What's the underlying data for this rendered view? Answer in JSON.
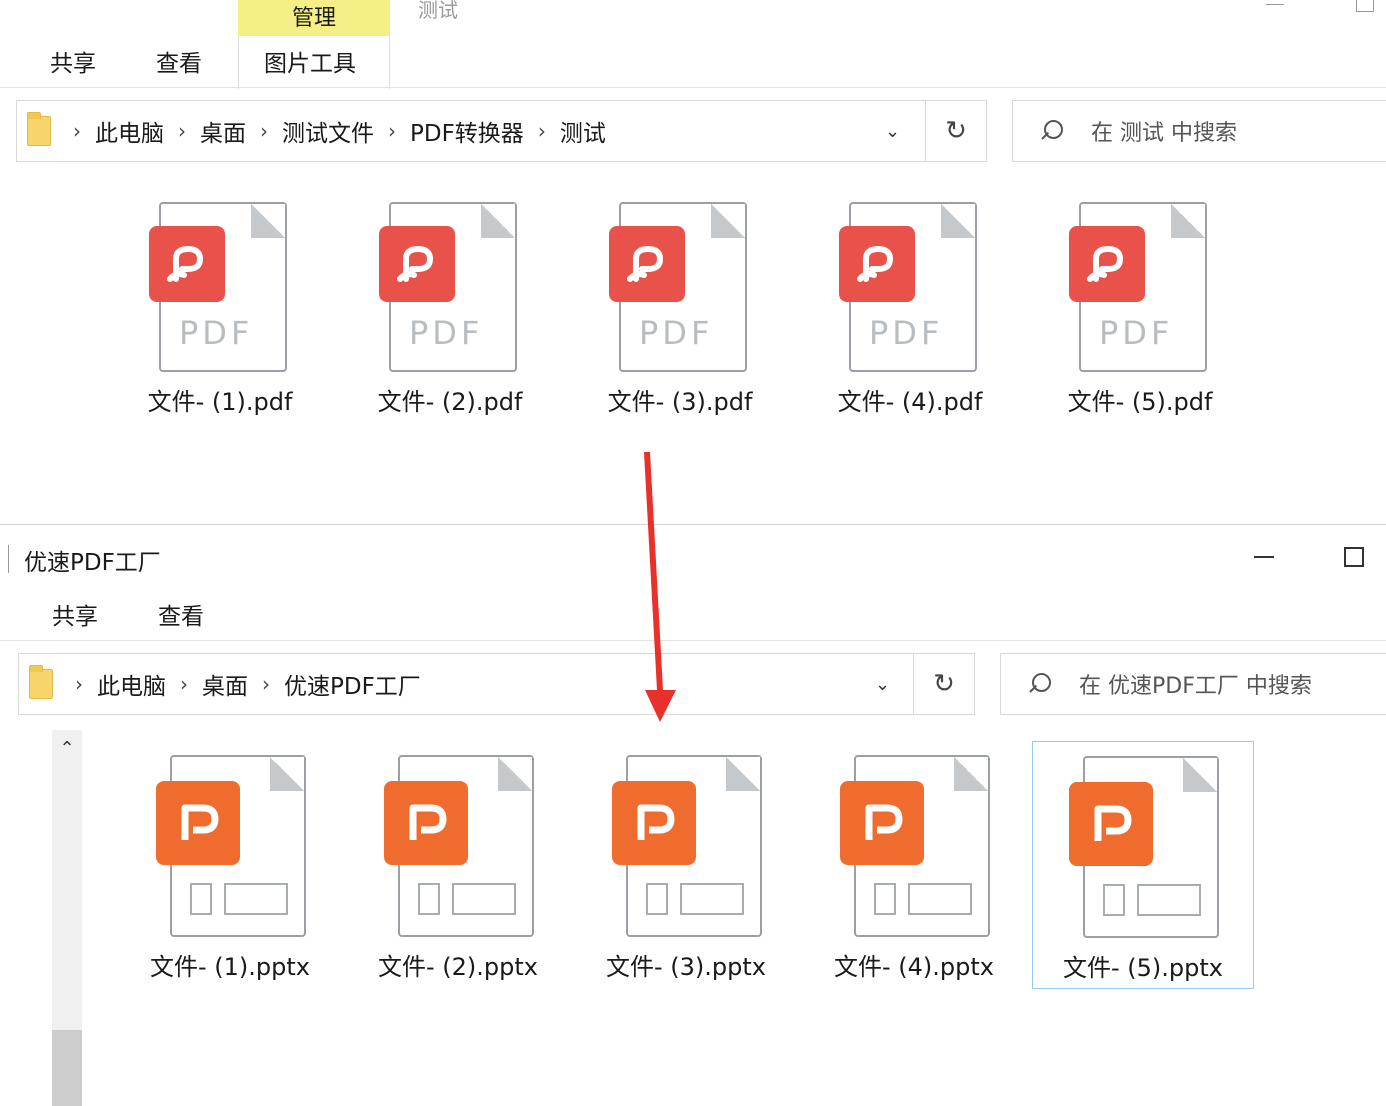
{
  "top_window": {
    "ribbon": {
      "manage_tab": "管理",
      "title_ghost": "测试",
      "tabs": [
        "共享",
        "查看",
        "图片工具"
      ]
    },
    "address": {
      "crumbs": [
        "此电脑",
        "桌面",
        "测试文件",
        "PDF转换器",
        "测试"
      ]
    },
    "search_placeholder": "在 测试 中搜索",
    "files": [
      {
        "name": "文件- (1).pdf",
        "type_label": "PDF"
      },
      {
        "name": "文件- (2).pdf",
        "type_label": "PDF"
      },
      {
        "name": "文件- (3).pdf",
        "type_label": "PDF"
      },
      {
        "name": "文件- (4).pdf",
        "type_label": "PDF"
      },
      {
        "name": "文件- (5).pdf",
        "type_label": "PDF"
      }
    ]
  },
  "bottom_window": {
    "title": "优速PDF工厂",
    "ribbon": {
      "tabs": [
        "共享",
        "查看"
      ]
    },
    "address": {
      "crumbs": [
        "此电脑",
        "桌面",
        "优速PDF工厂"
      ]
    },
    "search_placeholder": "在 优速PDF工厂 中搜索",
    "files": [
      {
        "name": "文件- (1).pptx"
      },
      {
        "name": "文件- (2).pptx"
      },
      {
        "name": "文件- (3).pptx"
      },
      {
        "name": "文件- (4).pptx"
      },
      {
        "name": "文件- (5).pptx",
        "selected": true
      }
    ]
  },
  "icons": {
    "refresh": "↻",
    "dropdown": "⌄",
    "chevron": "›",
    "scroll_up": "⌃"
  },
  "colors": {
    "pdf_badge": "#e9524a",
    "ppt_badge": "#f06c2e",
    "manage_tab": "#f4ef86",
    "arrow": "#e8312a",
    "selection_border": "#99c9ef"
  }
}
